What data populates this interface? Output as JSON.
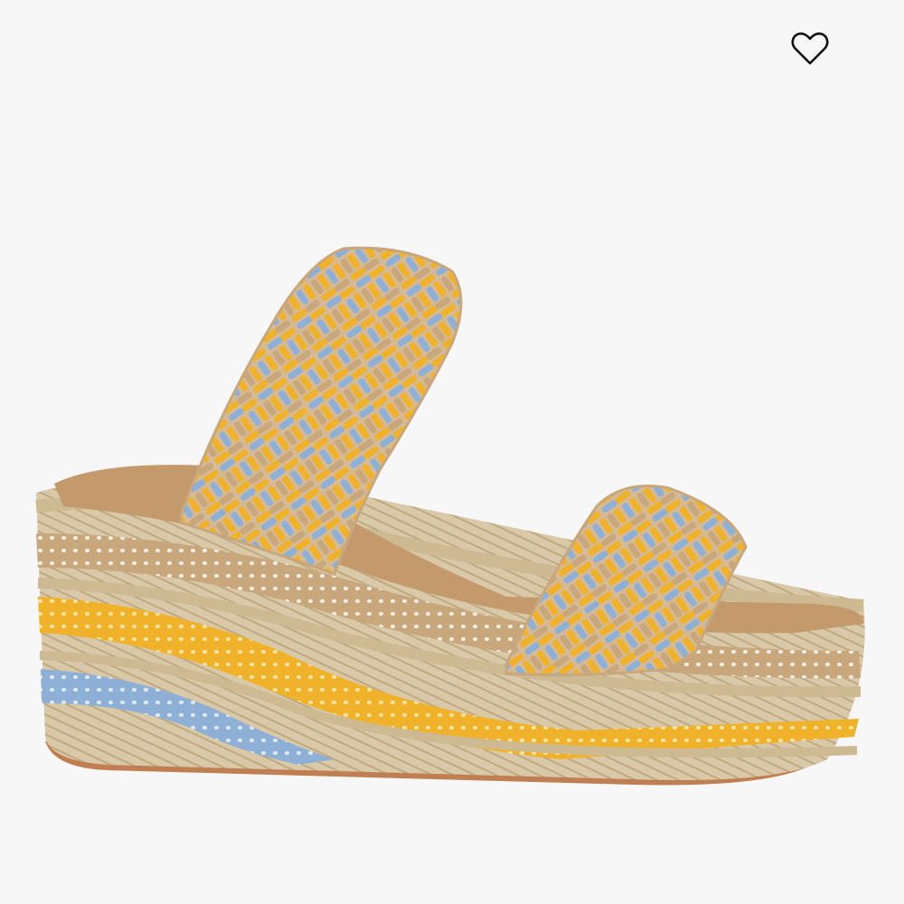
{
  "product": {
    "image_alt": "",
    "colors": {
      "background": "#f7f7f7",
      "jute": "#d9c9a8",
      "jute_dark": "#bfa981",
      "tan_cord": "#c9a77c",
      "yellow_cord": "#f0b22a",
      "blue_cord": "#8fb0d6",
      "footbed": "#c49a6c",
      "sole": "#c07f52"
    }
  },
  "wishlist": {
    "icon": "heart-outline-icon",
    "color": "#111111"
  }
}
